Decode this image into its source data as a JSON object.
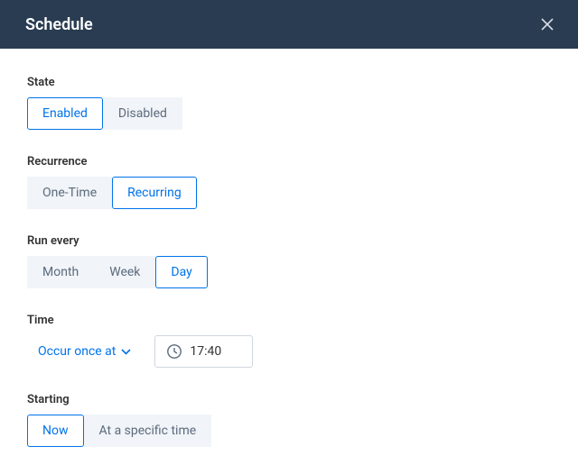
{
  "header": {
    "title": "Schedule"
  },
  "sections": {
    "state": {
      "label": "State",
      "options": {
        "enabled": "Enabled",
        "disabled": "Disabled"
      },
      "selected": "enabled"
    },
    "recurrence": {
      "label": "Recurrence",
      "options": {
        "onetime": "One-Time",
        "recurring": "Recurring"
      },
      "selected": "recurring"
    },
    "runevery": {
      "label": "Run every",
      "options": {
        "month": "Month",
        "week": "Week",
        "day": "Day"
      },
      "selected": "day"
    },
    "time": {
      "label": "Time",
      "dropdown_label": "Occur once at",
      "value": "17:40"
    },
    "starting": {
      "label": "Starting",
      "options": {
        "now": "Now",
        "specific": "At a specific time"
      },
      "selected": "now"
    }
  }
}
